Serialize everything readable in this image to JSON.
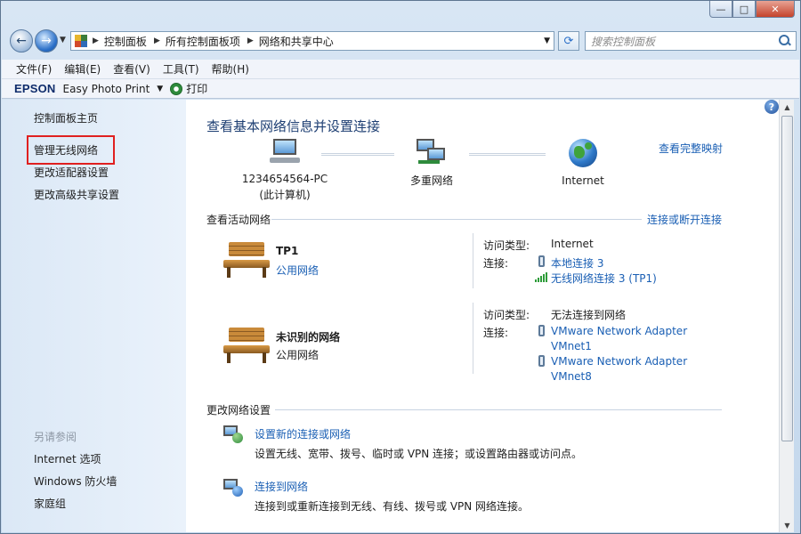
{
  "window": {
    "minimize": "—",
    "maximize": "□",
    "close": "✕"
  },
  "address": {
    "crumbs": [
      "控制面板",
      "所有控制面板项",
      "网络和共享中心"
    ],
    "search_placeholder": "搜索控制面板"
  },
  "menu": [
    "文件(F)",
    "编辑(E)",
    "查看(V)",
    "工具(T)",
    "帮助(H)"
  ],
  "epson": {
    "logo": "EPSON",
    "app": "Easy Photo Print",
    "print": "打印"
  },
  "left": {
    "home": "控制面板主页",
    "manage_wireless": "管理无线网络",
    "adapter": "更改适配器设置",
    "sharing": "更改高级共享设置",
    "see_also": "另请参阅",
    "internet_options": "Internet 选项",
    "firewall": "Windows 防火墙",
    "homegroup": "家庭组"
  },
  "main": {
    "help": "?",
    "title": "查看基本网络信息并设置连接",
    "full_map": "查看完整映射",
    "nodes": {
      "pc_name": "1234654564-PC",
      "pc_sub": "(此计算机)",
      "multi": "多重网络",
      "internet": "Internet"
    },
    "active_head": "查看活动网络",
    "connect_disconnect": "连接或断开连接",
    "networks": [
      {
        "name": "TP1",
        "type": "公用网络",
        "access_label": "访问类型:",
        "access_value": "Internet",
        "conn_label": "连接:",
        "connections": [
          "本地连接 3",
          "无线网络连接 3 (TP1)"
        ]
      },
      {
        "name": "未识别的网络",
        "type": "公用网络",
        "access_label": "访问类型:",
        "access_value": "无法连接到网络",
        "conn_label": "连接:",
        "connections": [
          "VMware Network Adapter",
          "VMnet1",
          "VMware Network Adapter",
          "VMnet8"
        ]
      }
    ],
    "change_head": "更改网络设置",
    "tasks": [
      {
        "link": "设置新的连接或网络",
        "desc": "设置无线、宽带、拨号、临时或 VPN 连接；或设置路由器或访问点。"
      },
      {
        "link": "连接到网络",
        "desc": "连接到或重新连接到无线、有线、拨号或 VPN 网络连接。"
      }
    ]
  }
}
